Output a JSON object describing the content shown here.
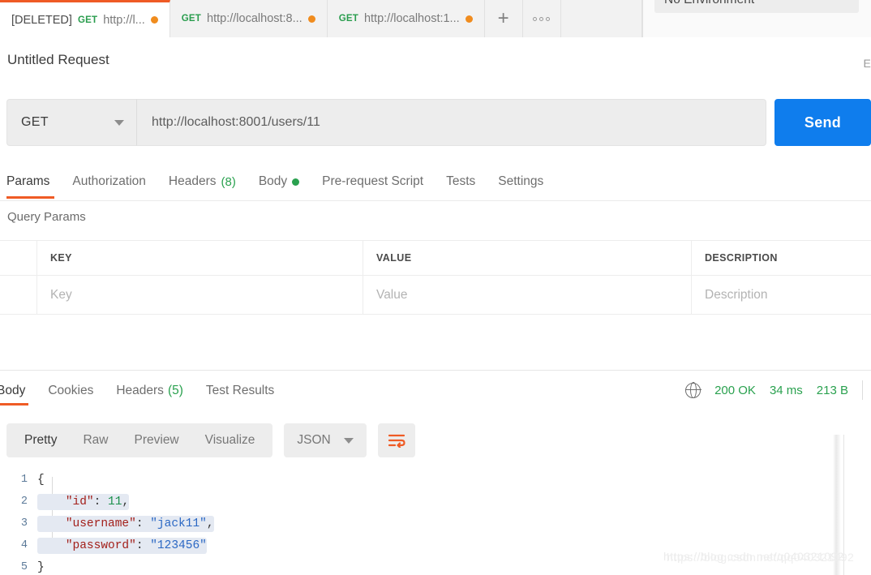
{
  "tabbar": {
    "tabs": [
      {
        "prefix": "[DELETED]",
        "method": "GET",
        "url": "http://l...",
        "unsaved": true,
        "active": true
      },
      {
        "prefix": "",
        "method": "GET",
        "url": "http://localhost:8...",
        "unsaved": true,
        "active": false
      },
      {
        "prefix": "",
        "method": "GET",
        "url": "http://localhost:1...",
        "unsaved": true,
        "active": false
      }
    ],
    "new_tab_label": "+",
    "more_label": "000",
    "environment": "No Environment"
  },
  "request": {
    "title": "Untitled Request",
    "right_label": "E",
    "method": "GET",
    "url": "http://localhost:8001/users/11",
    "send_label": "Send",
    "tabs": [
      {
        "label": "Params",
        "count": "",
        "dot": false,
        "active": true
      },
      {
        "label": "Authorization",
        "count": "",
        "dot": false,
        "active": false
      },
      {
        "label": "Headers",
        "count": "(8)",
        "dot": false,
        "active": false
      },
      {
        "label": "Body",
        "count": "",
        "dot": true,
        "active": false
      },
      {
        "label": "Pre-request Script",
        "count": "",
        "dot": false,
        "active": false
      },
      {
        "label": "Tests",
        "count": "",
        "dot": false,
        "active": false
      },
      {
        "label": "Settings",
        "count": "",
        "dot": false,
        "active": false
      }
    ],
    "query_params": {
      "section_label": "Query Params",
      "columns": [
        "KEY",
        "VALUE",
        "DESCRIPTION"
      ],
      "rows": [
        {
          "key": "Key",
          "value": "Value",
          "description": "Description"
        }
      ]
    }
  },
  "response": {
    "tabs": [
      {
        "label": "Body",
        "count": "",
        "active": true
      },
      {
        "label": "Cookies",
        "count": "",
        "active": false
      },
      {
        "label": "Headers",
        "count": "(5)",
        "active": false
      },
      {
        "label": "Test Results",
        "count": "",
        "active": false
      }
    ],
    "status": {
      "globe_icon": "globe-icon",
      "code": "200 OK",
      "time": "34 ms",
      "size": "213 B"
    },
    "viewer": {
      "modes": [
        {
          "label": "Pretty",
          "active": true
        },
        {
          "label": "Raw",
          "active": false
        },
        {
          "label": "Preview",
          "active": false
        },
        {
          "label": "Visualize",
          "active": false
        }
      ],
      "format": "JSON",
      "wrap_icon": "word-wrap-icon"
    },
    "body_lines": [
      {
        "num": "1",
        "tokens": [
          {
            "t": "{",
            "c": "k-punc"
          }
        ]
      },
      {
        "num": "2",
        "tokens": [
          {
            "t": "    ",
            "c": "k-punc"
          },
          {
            "t": "\"id\"",
            "c": "k-key"
          },
          {
            "t": ": ",
            "c": "k-punc"
          },
          {
            "t": "11",
            "c": "k-num"
          },
          {
            "t": ",",
            "c": "k-punc"
          }
        ]
      },
      {
        "num": "3",
        "tokens": [
          {
            "t": "    ",
            "c": "k-punc"
          },
          {
            "t": "\"username\"",
            "c": "k-key"
          },
          {
            "t": ": ",
            "c": "k-punc"
          },
          {
            "t": "\"jack11\"",
            "c": "k-str"
          },
          {
            "t": ",",
            "c": "k-punc"
          }
        ]
      },
      {
        "num": "4",
        "tokens": [
          {
            "t": "    ",
            "c": "k-punc"
          },
          {
            "t": "\"password\"",
            "c": "k-key"
          },
          {
            "t": ": ",
            "c": "k-punc"
          },
          {
            "t": "\"123456\"",
            "c": "k-str"
          }
        ]
      },
      {
        "num": "5",
        "tokens": [
          {
            "t": "}",
            "c": "k-punc"
          }
        ]
      }
    ]
  },
  "watermark": {
    "line1": "https://blog.csdn.net/q040321092",
    "line2": "https://blog.csdn.net/qq040321092"
  }
}
